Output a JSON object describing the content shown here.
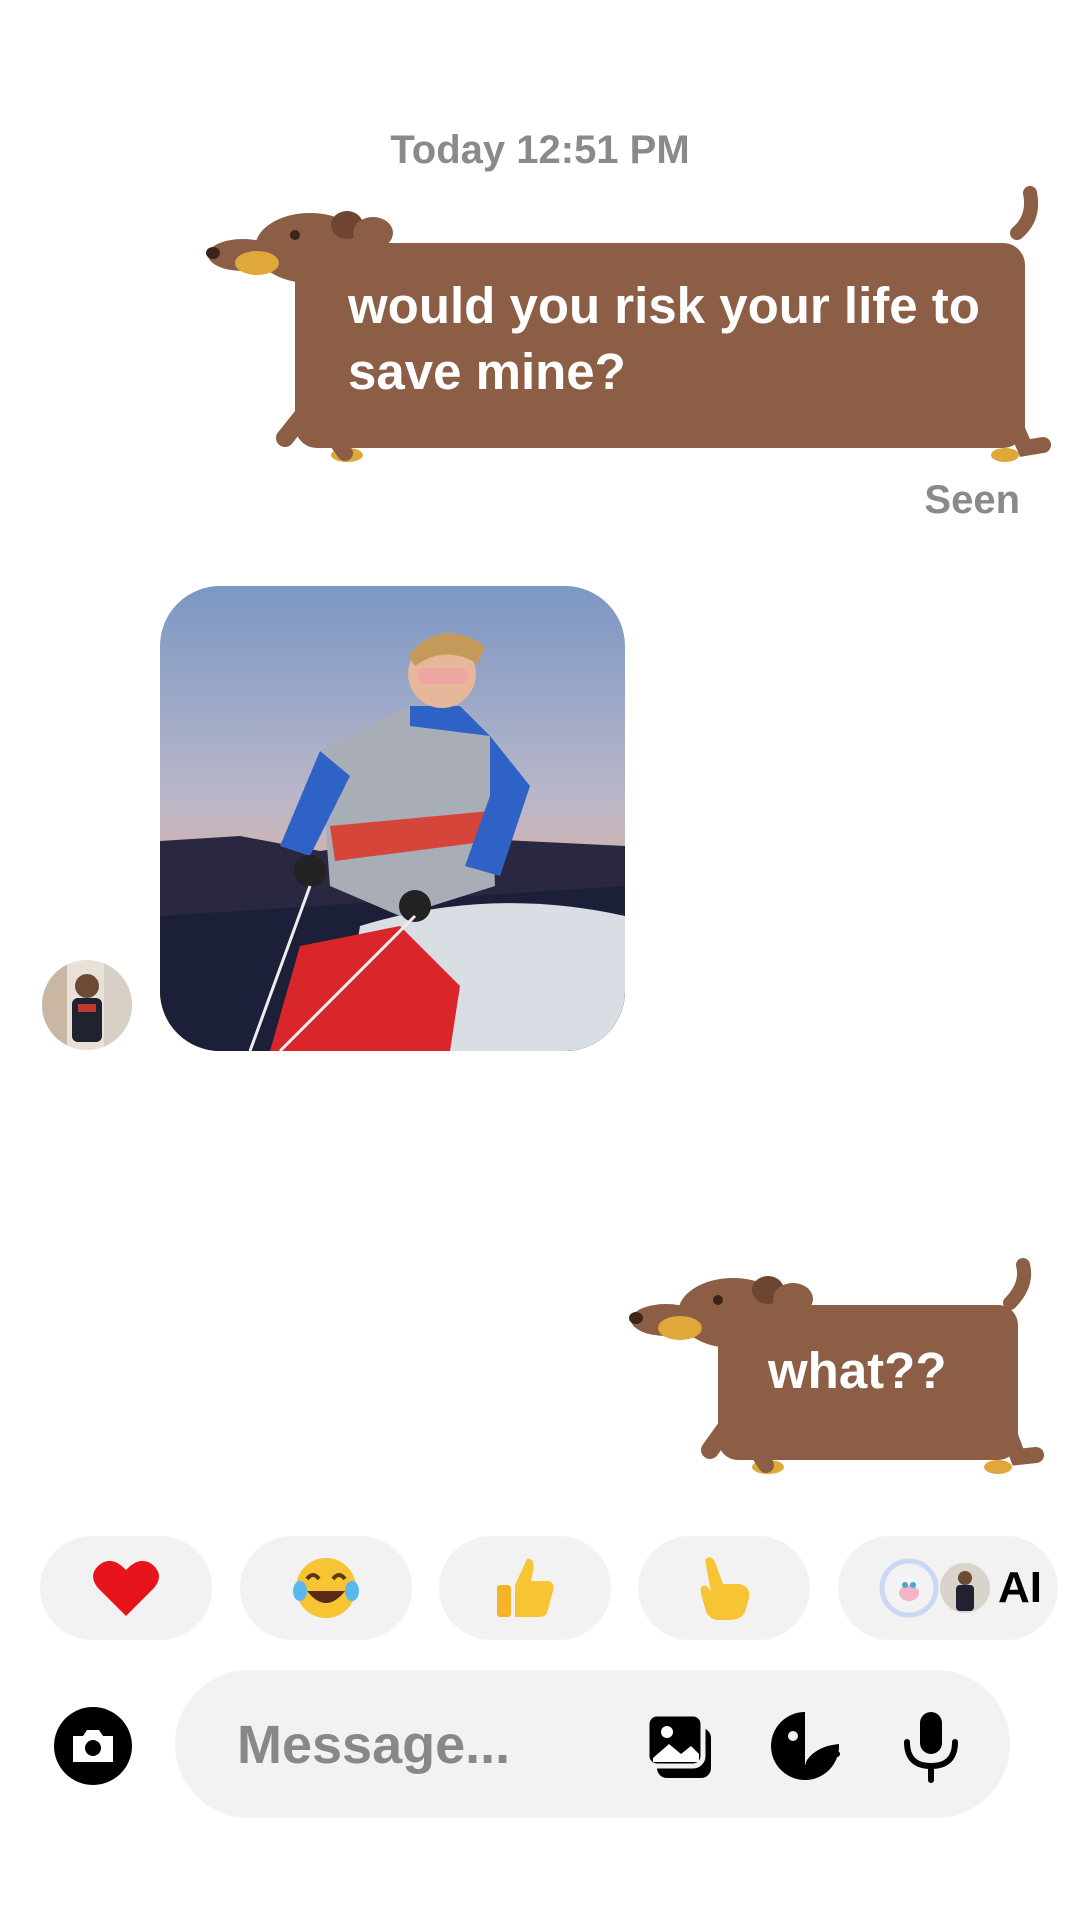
{
  "thread": {
    "timestamp": "Today 12:51 PM",
    "messages": [
      {
        "sender": "me",
        "text": "would you risk your life to save mine?"
      },
      {
        "sender": "them",
        "type": "image",
        "alt": "Photo"
      },
      {
        "sender": "me",
        "text": "what??"
      }
    ],
    "seen_label": "Seen"
  },
  "reactions": {
    "items": [
      {
        "emoji": "❤️",
        "icon": "heart-icon"
      },
      {
        "emoji": "😂",
        "icon": "tears-of-joy-icon"
      },
      {
        "emoji": "👍",
        "icon": "thumbs-up-icon"
      },
      {
        "emoji": "👆",
        "icon": "pointing-up-icon"
      }
    ],
    "ai_label": "AI"
  },
  "composer": {
    "placeholder": "Message..."
  },
  "colors": {
    "bubble_brown": "#8b5e45",
    "dog_brown": "#8b5e45",
    "muted_text": "#8a8a8a",
    "chip_bg": "#f2f2f2"
  }
}
